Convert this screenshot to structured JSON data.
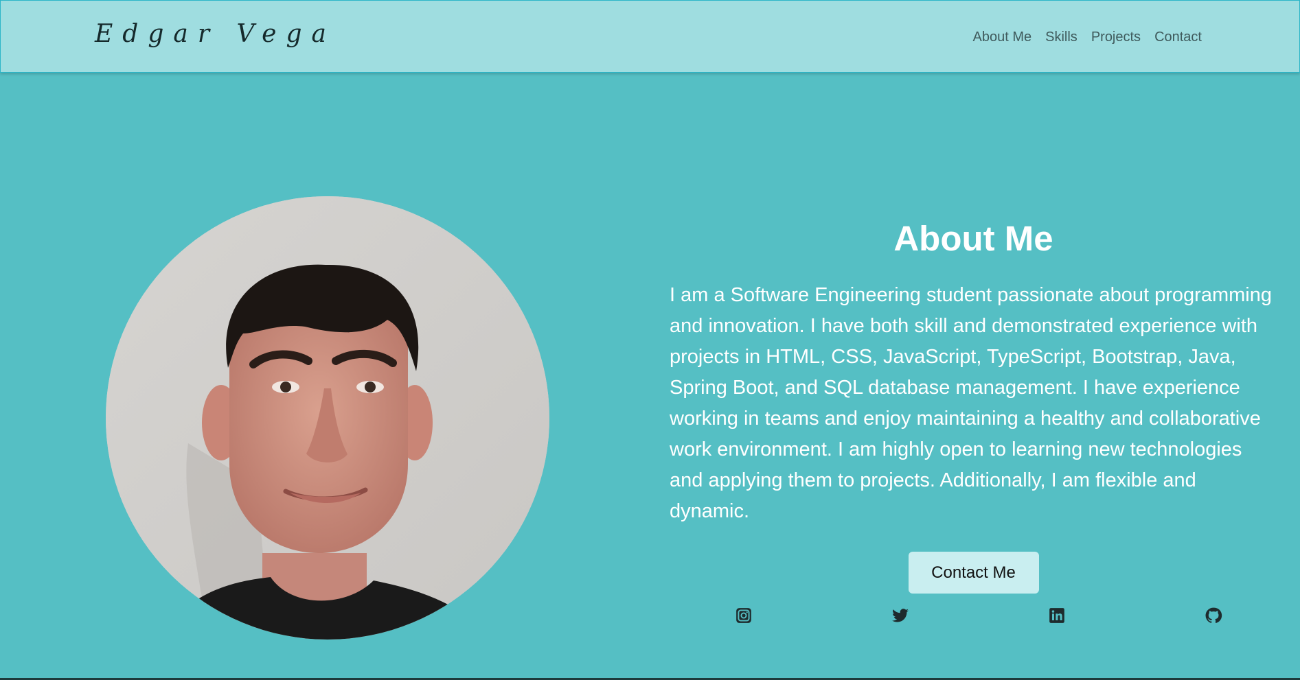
{
  "brand": {
    "name": "Edgar Vega"
  },
  "nav": {
    "items": [
      {
        "label": "About Me"
      },
      {
        "label": "Skills"
      },
      {
        "label": "Projects"
      },
      {
        "label": "Contact"
      }
    ]
  },
  "about": {
    "title": "About Me",
    "text": "I am a Software Engineering student passionate about programming and innovation. I have both skill and demonstrated experience with projects in HTML, CSS, JavaScript, TypeScript, Bootstrap, Java, Spring Boot, and SQL database management. I have experience working in teams and enjoy maintaining a healthy and collaborative work environment. I am highly open to learning new technologies and applying them to projects. Additionally, I am flexible and dynamic.",
    "button_label": "Contact Me"
  },
  "socials": [
    {
      "icon": "instagram-icon"
    },
    {
      "icon": "twitter-icon"
    },
    {
      "icon": "linkedin-icon"
    },
    {
      "icon": "github-icon"
    }
  ],
  "colors": {
    "background": "#55bfc4",
    "navbar": "#9fdde0",
    "button": "#c9eef0",
    "text_light": "#ffffff",
    "icon": "#1e2b2d"
  }
}
